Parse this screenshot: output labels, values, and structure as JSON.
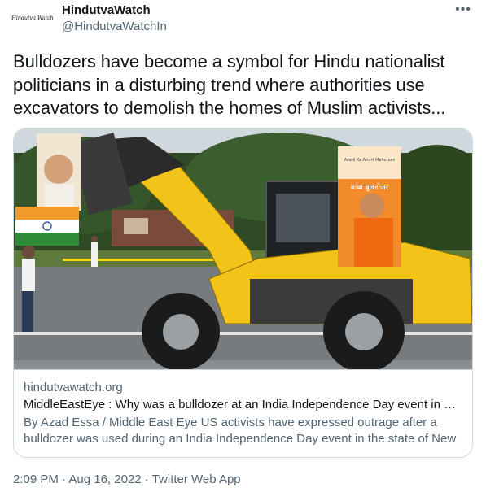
{
  "header": {
    "avatar_text": "Hindutva Watch",
    "display_name": "HindutvaWatch",
    "handle": "@HindutvaWatchIn",
    "more_label": "•••"
  },
  "tweet": {
    "text": "Bulldozers have become a symbol for Hindu nationalist politicians in a disturbing trend where authorities use excavators to demolish the homes of Muslim activists..."
  },
  "card": {
    "image_sign_text": "बाबा बुलडोजर",
    "image_sign_small": "Azadi Ka Amrit Mahotsav",
    "domain": "hindutvawatch.org",
    "title": "MiddleEastEye : Why was a bulldozer at an India Independence Day event in N...",
    "description": "By Azad Essa / Middle East Eye US activists have expressed outrage after a bulldozer was used during an India Independence Day event in the state of New"
  },
  "meta": {
    "time": "2:09 PM",
    "separator": " · ",
    "date": "Aug 16, 2022",
    "source": "Twitter Web App"
  },
  "colors": {
    "text_primary": "#0f1419",
    "text_secondary": "#536471",
    "border": "#cfd9de",
    "bulldozer_yellow": "#f2c318"
  }
}
